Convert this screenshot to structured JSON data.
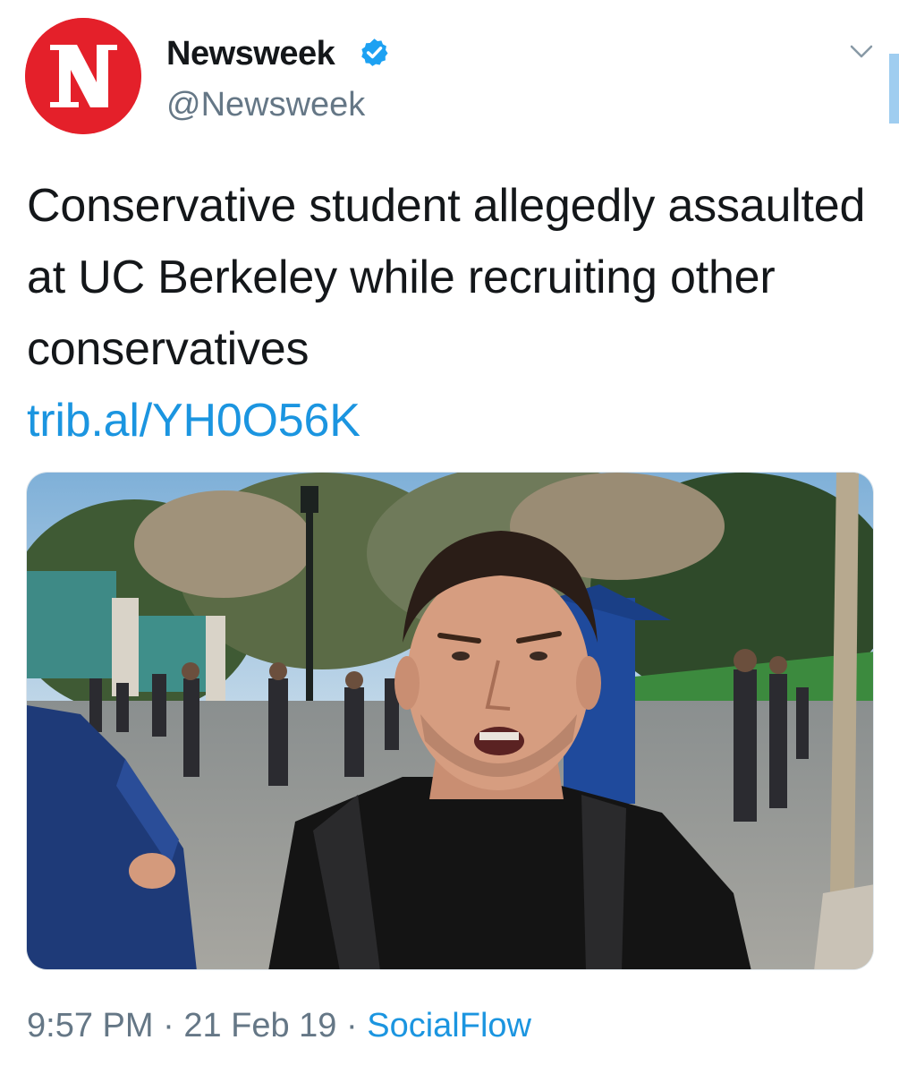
{
  "author": {
    "display_name": "Newsweek",
    "handle": "@Newsweek",
    "avatar_letter": "N",
    "avatar_color": "#e4202a",
    "verified": true
  },
  "tweet": {
    "text": "Conservative student allegedly assaulted at UC Berkeley while recruiting other conservatives",
    "link": "trib.al/YH0O56K",
    "image_icon": "photo-of-man-on-campus"
  },
  "meta": {
    "time": "9:57 PM",
    "separator": "·",
    "date": "21 Feb 19",
    "source": "SocialFlow"
  },
  "colors": {
    "link": "#1b95e0",
    "muted": "#657786",
    "text": "#14171a",
    "verified": "#1da1f2"
  },
  "icons": {
    "verified": "verified-badge-icon",
    "menu": "chevron-down-icon"
  }
}
